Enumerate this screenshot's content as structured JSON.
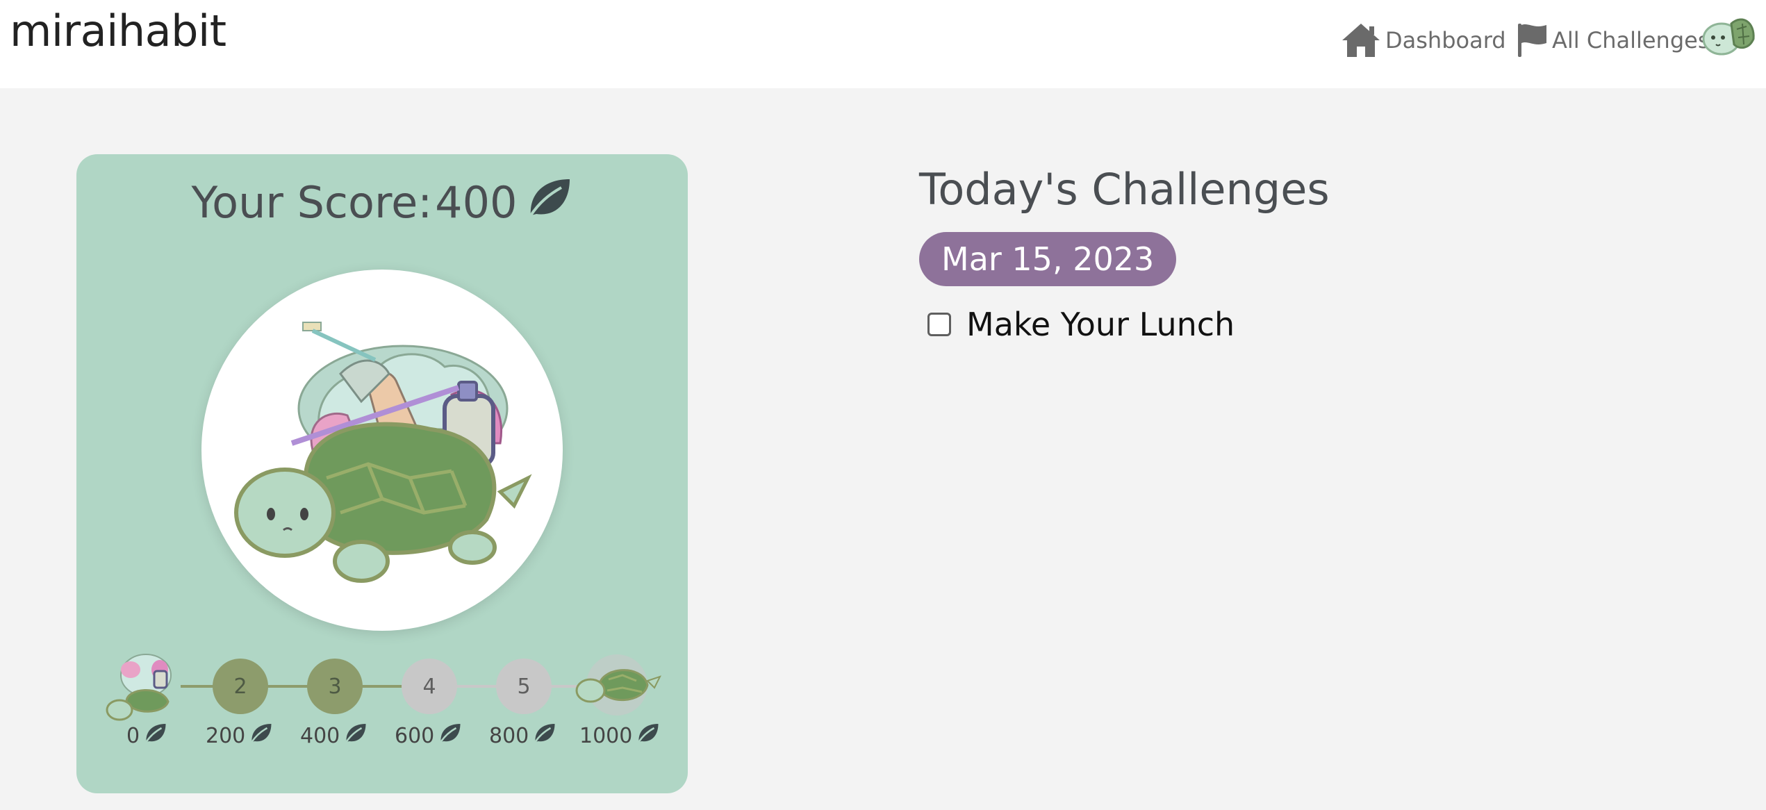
{
  "header": {
    "brand": "miraihabit",
    "nav": [
      {
        "label": "Dashboard",
        "icon": "home-icon"
      },
      {
        "label": "All Challenges",
        "icon": "flag-icon"
      }
    ],
    "avatar_icon": "turtle-avatar-icon"
  },
  "score_card": {
    "label": "Your Score:",
    "value": "400",
    "unit_icon": "leaf-icon",
    "progress": {
      "current_level": 3,
      "levels": [
        {
          "level": 1,
          "text": "",
          "points": "0",
          "state": "done",
          "picture": "turtle-with-trash"
        },
        {
          "level": 2,
          "text": "2",
          "points": "200",
          "state": "done"
        },
        {
          "level": 3,
          "text": "3",
          "points": "400",
          "state": "done"
        },
        {
          "level": 4,
          "text": "4",
          "points": "600",
          "state": "todo"
        },
        {
          "level": 5,
          "text": "5",
          "points": "800",
          "state": "todo"
        },
        {
          "level": 6,
          "text": "",
          "points": "1000",
          "state": "todo",
          "picture": "clean-turtle"
        }
      ]
    }
  },
  "challenges": {
    "title": "Today's Challenges",
    "date": "Mar 15, 2023",
    "items": [
      {
        "label": "Make Your Lunch",
        "checked": false
      }
    ]
  },
  "colors": {
    "card": "#b0d6c5",
    "date_pill": "#8e729a",
    "level_done": "#8d9c6c",
    "level_todo": "#c8c8c8"
  }
}
